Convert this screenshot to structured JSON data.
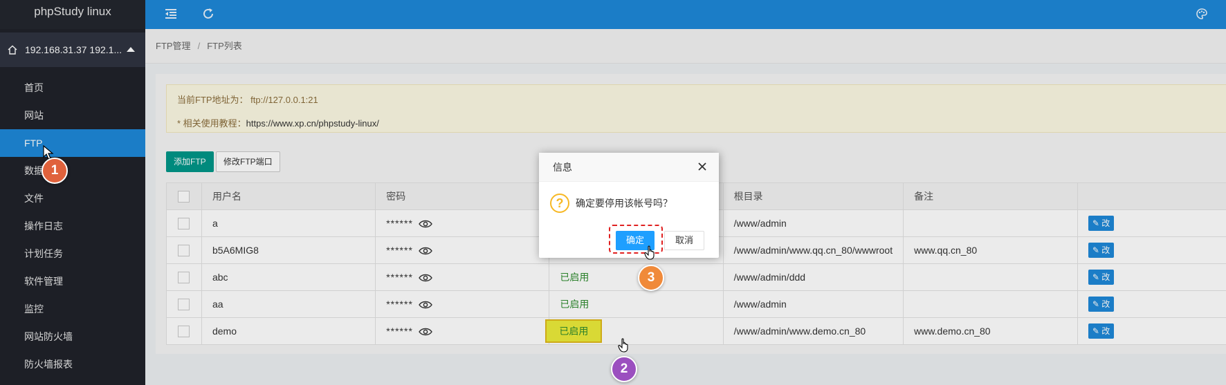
{
  "app": {
    "title": "phpStudy linux"
  },
  "host": {
    "label": "192.168.31.37 192.1..."
  },
  "sidebar": {
    "items": [
      {
        "label": "首页"
      },
      {
        "label": "网站"
      },
      {
        "label": "FTP"
      },
      {
        "label": "数据"
      },
      {
        "label": "文件"
      },
      {
        "label": "操作日志"
      },
      {
        "label": "计划任务"
      },
      {
        "label": "软件管理"
      },
      {
        "label": "监控"
      },
      {
        "label": "网站防火墙"
      },
      {
        "label": "防火墙报表"
      }
    ],
    "active_index": 2
  },
  "breadcrumb": {
    "parent": "FTP管理",
    "separator": "/",
    "current": "FTP列表"
  },
  "notice": {
    "line1": "当前FTP地址为： ftp://127.0.0.1:21",
    "line2_prefix": "* 相关使用教程：",
    "line2_link": "https://www.xp.cn/phpstudy-linux/"
  },
  "toolbar": {
    "add_label": "添加FTP",
    "port_label": "修改FTP端口"
  },
  "table": {
    "headers": {
      "username": "用户名",
      "password": "密码",
      "status": "",
      "root": "根目录",
      "note": "备注"
    },
    "rows": [
      {
        "username": "a",
        "password": "******",
        "status": "",
        "root": "/www/admin",
        "note": "",
        "action": "改"
      },
      {
        "username": "b5A6MIG8",
        "password": "******",
        "status": "",
        "root": "/www/admin/www.qq.cn_80/wwwroot",
        "note": "www.qq.cn_80",
        "action": "改"
      },
      {
        "username": "abc",
        "password": "******",
        "status": "已启用",
        "root": "/www/admin/ddd",
        "note": "",
        "action": "改"
      },
      {
        "username": "aa",
        "password": "******",
        "status": "已启用",
        "root": "/www/admin",
        "note": "",
        "action": "改"
      },
      {
        "username": "demo",
        "password": "******",
        "status": "已启用",
        "root": "/www/admin/www.demo.cn_80",
        "note": "www.demo.cn_80",
        "action": "改"
      }
    ]
  },
  "dialog": {
    "title": "信息",
    "message": "确定要停用该帐号吗？",
    "ok_label": "确定",
    "cancel_label": "取消"
  },
  "steps": {
    "one": "1",
    "two": "2",
    "three": "3"
  },
  "colors": {
    "primary": "#1e88d8",
    "sidebar": "#20222a",
    "add_button": "#009688",
    "dialog_ok": "#1e9fff",
    "status": "#2e8b2e"
  }
}
